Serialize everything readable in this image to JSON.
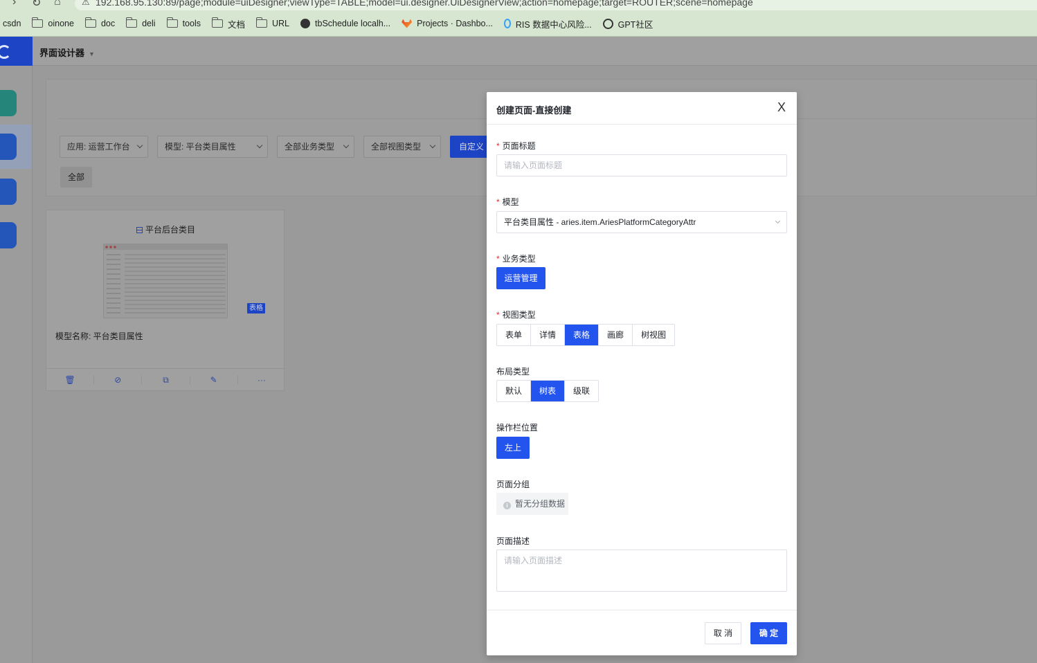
{
  "browser": {
    "url": "192.168.95.130:89/page;module=uiDesigner;viewType=TABLE;model=ui.designer.UiDesignerView;action=homepage;target=ROUTER;scene=homepage",
    "bookmarks": [
      {
        "label": "csdn",
        "icon": "none"
      },
      {
        "label": "oinone",
        "icon": "folder"
      },
      {
        "label": "doc",
        "icon": "folder"
      },
      {
        "label": "deli",
        "icon": "folder"
      },
      {
        "label": "tools",
        "icon": "folder"
      },
      {
        "label": "文档",
        "icon": "folder"
      },
      {
        "label": "URL",
        "icon": "folder"
      },
      {
        "label": "tbSchedule localh...",
        "icon": "globe"
      },
      {
        "label": "Projects · Dashbo...",
        "icon": "gitlab"
      },
      {
        "label": "RIS 数据中心风险...",
        "icon": "ris"
      },
      {
        "label": "GPT社区",
        "icon": "openai"
      }
    ]
  },
  "app": {
    "title": "界面设计器",
    "filters": {
      "app": "应用: 运营工作台",
      "model": "模型: 平台类目属性",
      "biz_type": "全部业务类型",
      "view_type": "全部视图类型",
      "custom": "自定义",
      "all": "全部"
    },
    "card": {
      "title": "平台后台类目",
      "badge": "表格",
      "meta": "模型名称: 平台类目属性",
      "actions": [
        "delete-icon",
        "hide-icon",
        "copy-icon",
        "edit-icon",
        "more-icon"
      ]
    }
  },
  "modal": {
    "title": "创建页面-直接创建",
    "close": "X",
    "page_title": {
      "label": "页面标题",
      "placeholder": "请输入页面标题",
      "value": ""
    },
    "model": {
      "label": "模型",
      "value": "平台类目属性 - aries.item.AriesPlatformCategoryAttr"
    },
    "biz_type": {
      "label": "业务类型",
      "selected": "运营管理"
    },
    "view_type": {
      "label": "视图类型",
      "options": [
        "表单",
        "详情",
        "表格",
        "画廊",
        "树视图"
      ],
      "selected_index": 2
    },
    "layout_type": {
      "label": "布局类型",
      "options": [
        "默认",
        "树表",
        "级联"
      ],
      "selected_index": 1
    },
    "action_bar": {
      "label": "操作栏位置",
      "selected": "左上"
    },
    "page_group": {
      "label": "页面分组",
      "empty": "暂无分组数据"
    },
    "page_desc": {
      "label": "页面描述",
      "placeholder": "请输入页面描述",
      "value": ""
    },
    "cancel": "取 消",
    "ok": "确 定"
  },
  "colors": {
    "primary": "#2454ee",
    "required": "#f5222d",
    "overlay": "#9a9a9a"
  }
}
